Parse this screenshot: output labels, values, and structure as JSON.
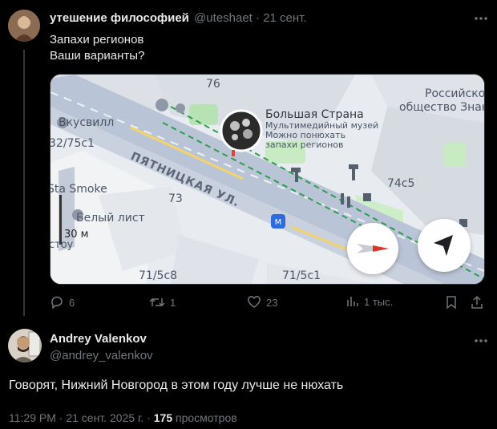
{
  "tweet1": {
    "author_name": "утешение философией",
    "handle": "@uteshaet",
    "separator": "·",
    "date": "21 сент.",
    "text_line1": "Запахи регионов",
    "text_line2": "Ваши варианты?",
    "actions": {
      "replies": "6",
      "retweets": "1",
      "likes": "23",
      "views": "1 тыс."
    }
  },
  "map": {
    "labels": {
      "building_76": "76",
      "vkusvill": "Вкусвилл",
      "addr_32_75c1": "32/75с1",
      "street": "ПЯТНИЦКАЯ УЛ.",
      "sta_smoke": "Sta Smoke",
      "building_73": "73",
      "belyi_list": "Белый лист",
      "scale": "30 м",
      "addr_71_5c8": "71/5с8",
      "addr_71_5c1": "71/5с1",
      "addr_74c5": "74с5",
      "russian_society_1": "Российско",
      "russian_society_2": "общество Знани",
      "poi_title": "Большая Страна",
      "poi_sub1": "Мультимедийный музей",
      "poi_sub2": "Можно понюхать",
      "poi_sub3": "запахи регионов",
      "partial_stoy": "стоу"
    },
    "colors": {
      "street": "#b8c4d8",
      "tram_line": "#2e9d4f",
      "park": "#c4e8c0",
      "building": "#dfe3e9"
    }
  },
  "tweet2": {
    "author_name": "Andrey Valenkov",
    "handle": "@andrey_valenkov",
    "text": "Говорят, Нижний Новгород в этом году лучше не нюхать",
    "meta": {
      "time": "11:29 PM",
      "dot": "·",
      "date": "21 сент. 2025 г.",
      "dot2": "·",
      "views_count": "175",
      "views_label": "просмотров"
    }
  },
  "icons": [
    "reply-icon",
    "retweet-icon",
    "like-icon",
    "views-icon",
    "bookmark-icon",
    "share-icon",
    "more-icon",
    "navigation-arrow-icon",
    "compass-icon"
  ]
}
